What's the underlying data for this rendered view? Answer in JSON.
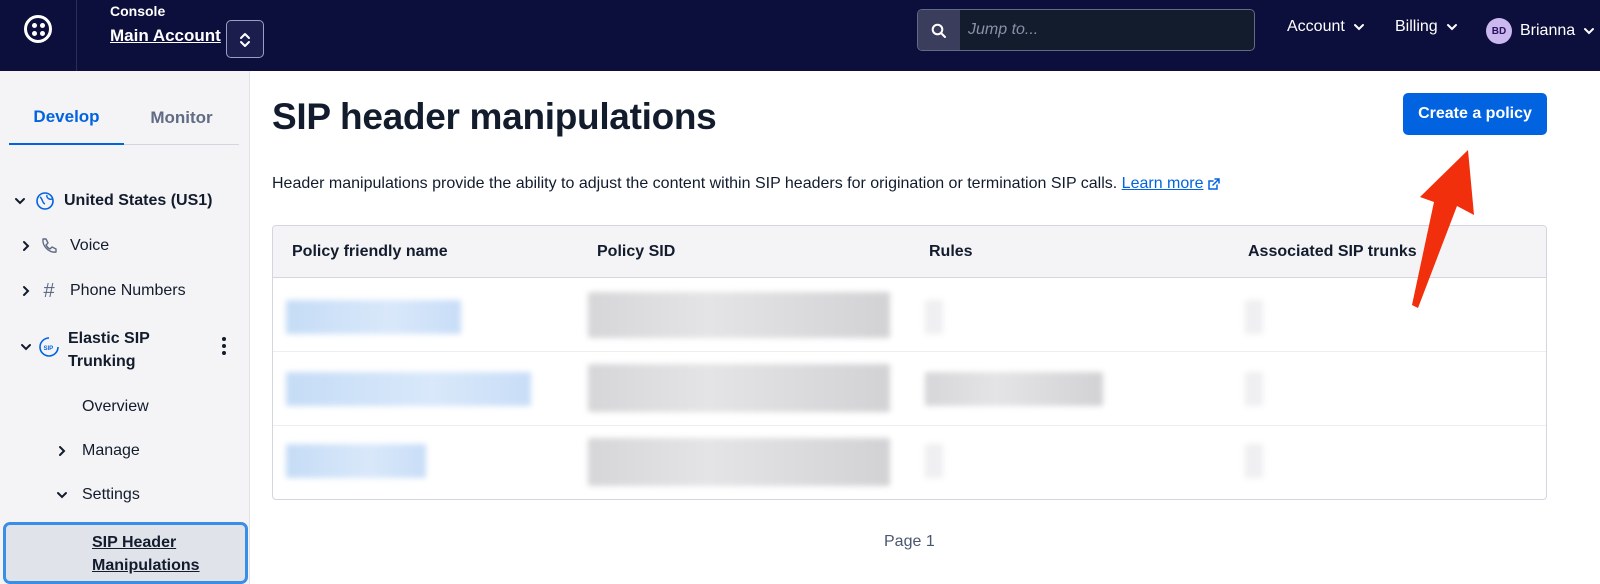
{
  "header": {
    "console_label": "Console",
    "account_name": "Main Account",
    "search_placeholder": "Jump to...",
    "menu_account": "Account",
    "menu_billing": "Billing",
    "user_initials": "BD",
    "user_name": "Brianna"
  },
  "sidebar": {
    "tabs": [
      "Develop",
      "Monitor"
    ],
    "active_tab": "Develop",
    "region": "United States (US1)",
    "voice": "Voice",
    "phone_numbers": "Phone Numbers",
    "elastic_sip_line1": "Elastic SIP",
    "elastic_sip_line2": "Trunking",
    "sip_badge": "SIP",
    "overview": "Overview",
    "manage": "Manage",
    "settings": "Settings",
    "active_item": "SIP Header Manipulations"
  },
  "main": {
    "title": "SIP header manipulations",
    "create_button": "Create a policy",
    "description": "Header manipulations provide the ability to adjust the content within SIP headers for origination or termination SIP calls.",
    "learn_more": "Learn more",
    "table": {
      "columns": [
        "Policy friendly name",
        "Policy SID",
        "Rules",
        "Associated SIP trunks"
      ]
    },
    "pagination": "Page 1"
  },
  "colors": {
    "topbar": "#0c0e3b",
    "primary": "#0263e0",
    "annotation_arrow": "#f22f0c"
  }
}
